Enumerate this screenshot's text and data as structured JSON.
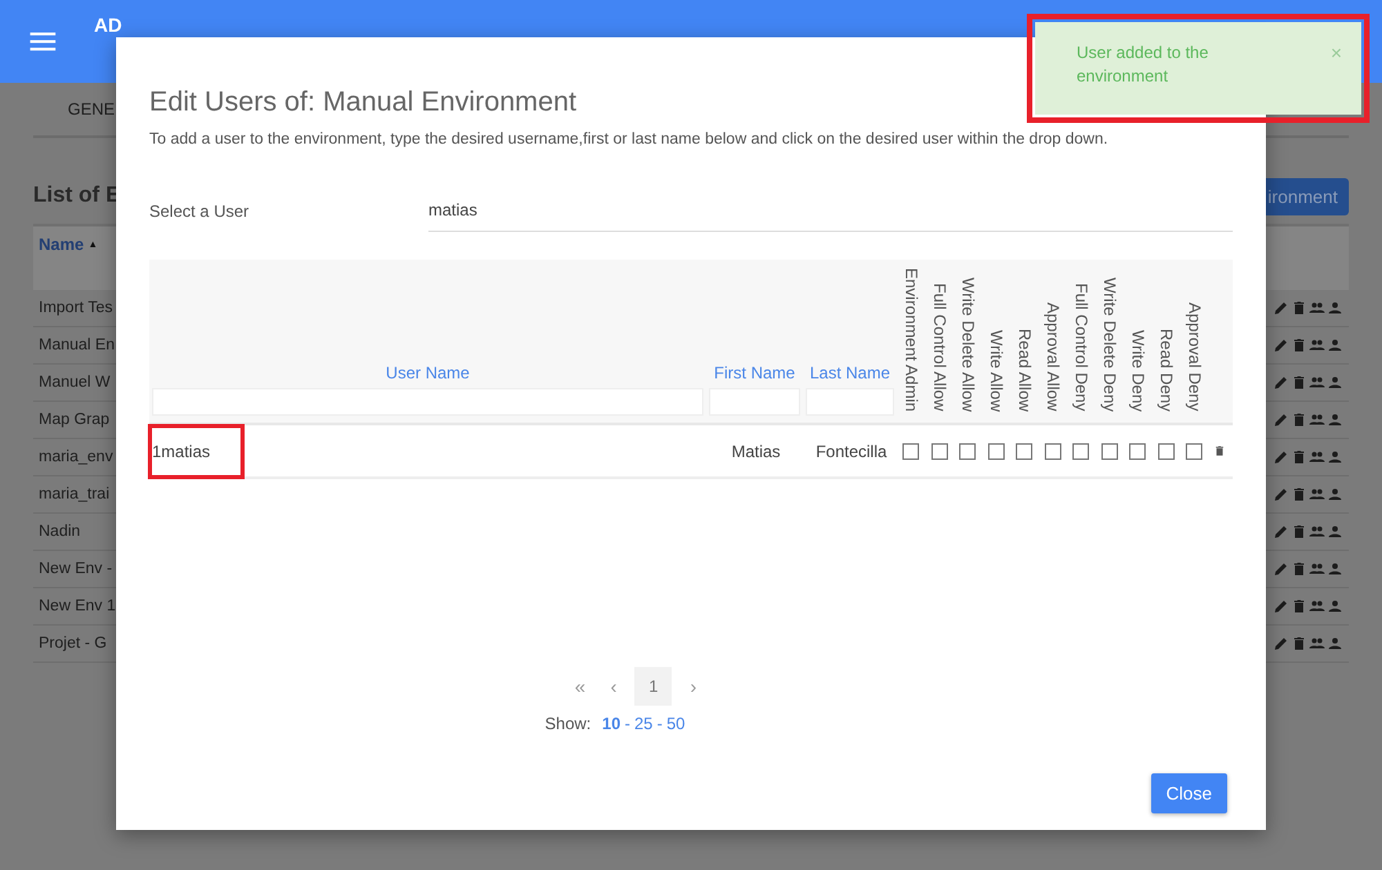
{
  "app_bar": {
    "title": "AD"
  },
  "background": {
    "tab": "GENE",
    "heading": "List of E",
    "add_button": "ironment",
    "table": {
      "columns": [
        {
          "label": "Name",
          "sort_mark": "▲"
        }
      ],
      "rows": [
        {
          "name": "Import Tes"
        },
        {
          "name": "Manual En"
        },
        {
          "name": "Manuel W"
        },
        {
          "name": "Map Grap"
        },
        {
          "name": "maria_env"
        },
        {
          "name": "maria_trai"
        },
        {
          "name": "Nadin"
        },
        {
          "name": "New Env -"
        },
        {
          "name": "New Env 1"
        },
        {
          "name": "Projet - G"
        }
      ]
    }
  },
  "dialog": {
    "title": "Edit Users of: Manual Environment",
    "description": "To add a user to the environment, type the desired username,first or last name below and click on the desired user within the drop down.",
    "select_label": "Select a User",
    "select_value": "matias",
    "table": {
      "columns": [
        "User Name",
        "First Name",
        "Last Name"
      ],
      "permission_columns": [
        "Environment Admin",
        "Full Control Allow",
        "Write Delete Allow",
        "Write Allow",
        "Read Allow",
        "Approval Allow",
        "Full Control Deny",
        "Write Delete Deny",
        "Write Deny",
        "Read Deny",
        "Approval Deny"
      ],
      "rows": [
        {
          "user_name": "1matias",
          "highlighted": true,
          "first_name": "Matias",
          "last_name": "Fontecilla",
          "permissions": [
            {
              "checked": false
            },
            {
              "checked": false
            },
            {
              "checked": false
            },
            {
              "checked": false
            },
            {
              "checked": false
            },
            {
              "checked": false
            },
            {
              "checked": false
            },
            {
              "checked": false
            },
            {
              "checked": false
            },
            {
              "checked": false
            },
            {
              "checked": false
            }
          ]
        }
      ]
    },
    "pagination": {
      "first": "«",
      "prev": "‹",
      "next": "›",
      "pages": [
        {
          "label": "1",
          "selected": true
        }
      ]
    },
    "page_size": {
      "label": "Show:",
      "separator": "-",
      "options": [
        {
          "label": "10",
          "selected": true
        },
        {
          "label": "25",
          "selected": false
        },
        {
          "label": "50",
          "selected": false
        }
      ]
    },
    "close_button": "Close"
  },
  "toast": {
    "message": "User added to the environment",
    "close": "×",
    "highlighted": true
  }
}
